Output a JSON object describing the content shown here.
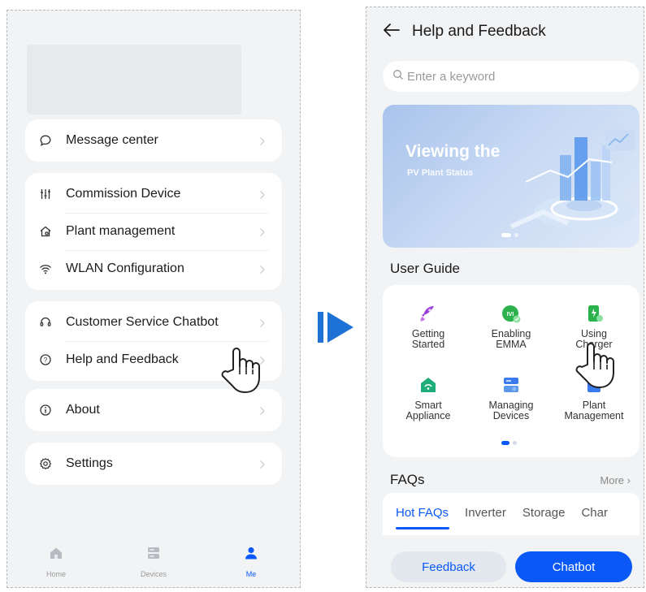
{
  "left_screen": {
    "menu_groups": [
      {
        "items": [
          {
            "label": "Message center",
            "icon": "message-icon"
          }
        ]
      },
      {
        "items": [
          {
            "label": "Commission Device",
            "icon": "sliders-icon"
          },
          {
            "label": "Plant management",
            "icon": "plant-home-icon"
          },
          {
            "label": "WLAN Configuration",
            "icon": "wifi-icon"
          }
        ]
      },
      {
        "items": [
          {
            "label": "Customer Service Chatbot",
            "icon": "headset-icon"
          },
          {
            "label": "Help and Feedback",
            "icon": "help-icon"
          }
        ]
      },
      {
        "items": [
          {
            "label": "About",
            "icon": "info-icon"
          }
        ]
      },
      {
        "items": [
          {
            "label": "Settings",
            "icon": "gear-icon"
          }
        ]
      }
    ],
    "bottom_nav": [
      {
        "label": "Home",
        "icon": "home-icon",
        "active": false
      },
      {
        "label": "Devices",
        "icon": "devices-icon",
        "active": false
      },
      {
        "label": "Me",
        "icon": "person-icon",
        "active": true
      }
    ]
  },
  "right_screen": {
    "title": "Help and Feedback",
    "search_placeholder": "Enter a keyword",
    "banner": {
      "title": "Viewing the",
      "subtitle": "PV Plant Status"
    },
    "user_guide": {
      "title": "User Guide",
      "items": [
        {
          "label": "Getting\nStarted",
          "icon": "rocket-icon",
          "color": "#9b3fd6"
        },
        {
          "label": "Enabling\nEMMA",
          "icon": "emma-icon",
          "color": "#2bb24c"
        },
        {
          "label": "Using\nCharger",
          "icon": "charger-icon",
          "color": "#2bb24c"
        },
        {
          "label": "Smart\nAppliance",
          "icon": "smart-home-icon",
          "color": "#1fae7a"
        },
        {
          "label": "Managing\nDevices",
          "icon": "server-icon",
          "color": "#3a7bf0"
        },
        {
          "label": "Plant\nManagement",
          "icon": "plant-icon",
          "color": "#3a7bf0"
        }
      ]
    },
    "faqs": {
      "title": "FAQs",
      "more_label": "More",
      "tabs": [
        "Hot FAQs",
        "Inverter",
        "Storage",
        "Char"
      ]
    },
    "buttons": {
      "feedback": "Feedback",
      "chatbot": "Chatbot"
    }
  },
  "colors": {
    "accent": "#0a59f7",
    "background": "#f1f3f5",
    "arrow": "#1e72d6"
  }
}
